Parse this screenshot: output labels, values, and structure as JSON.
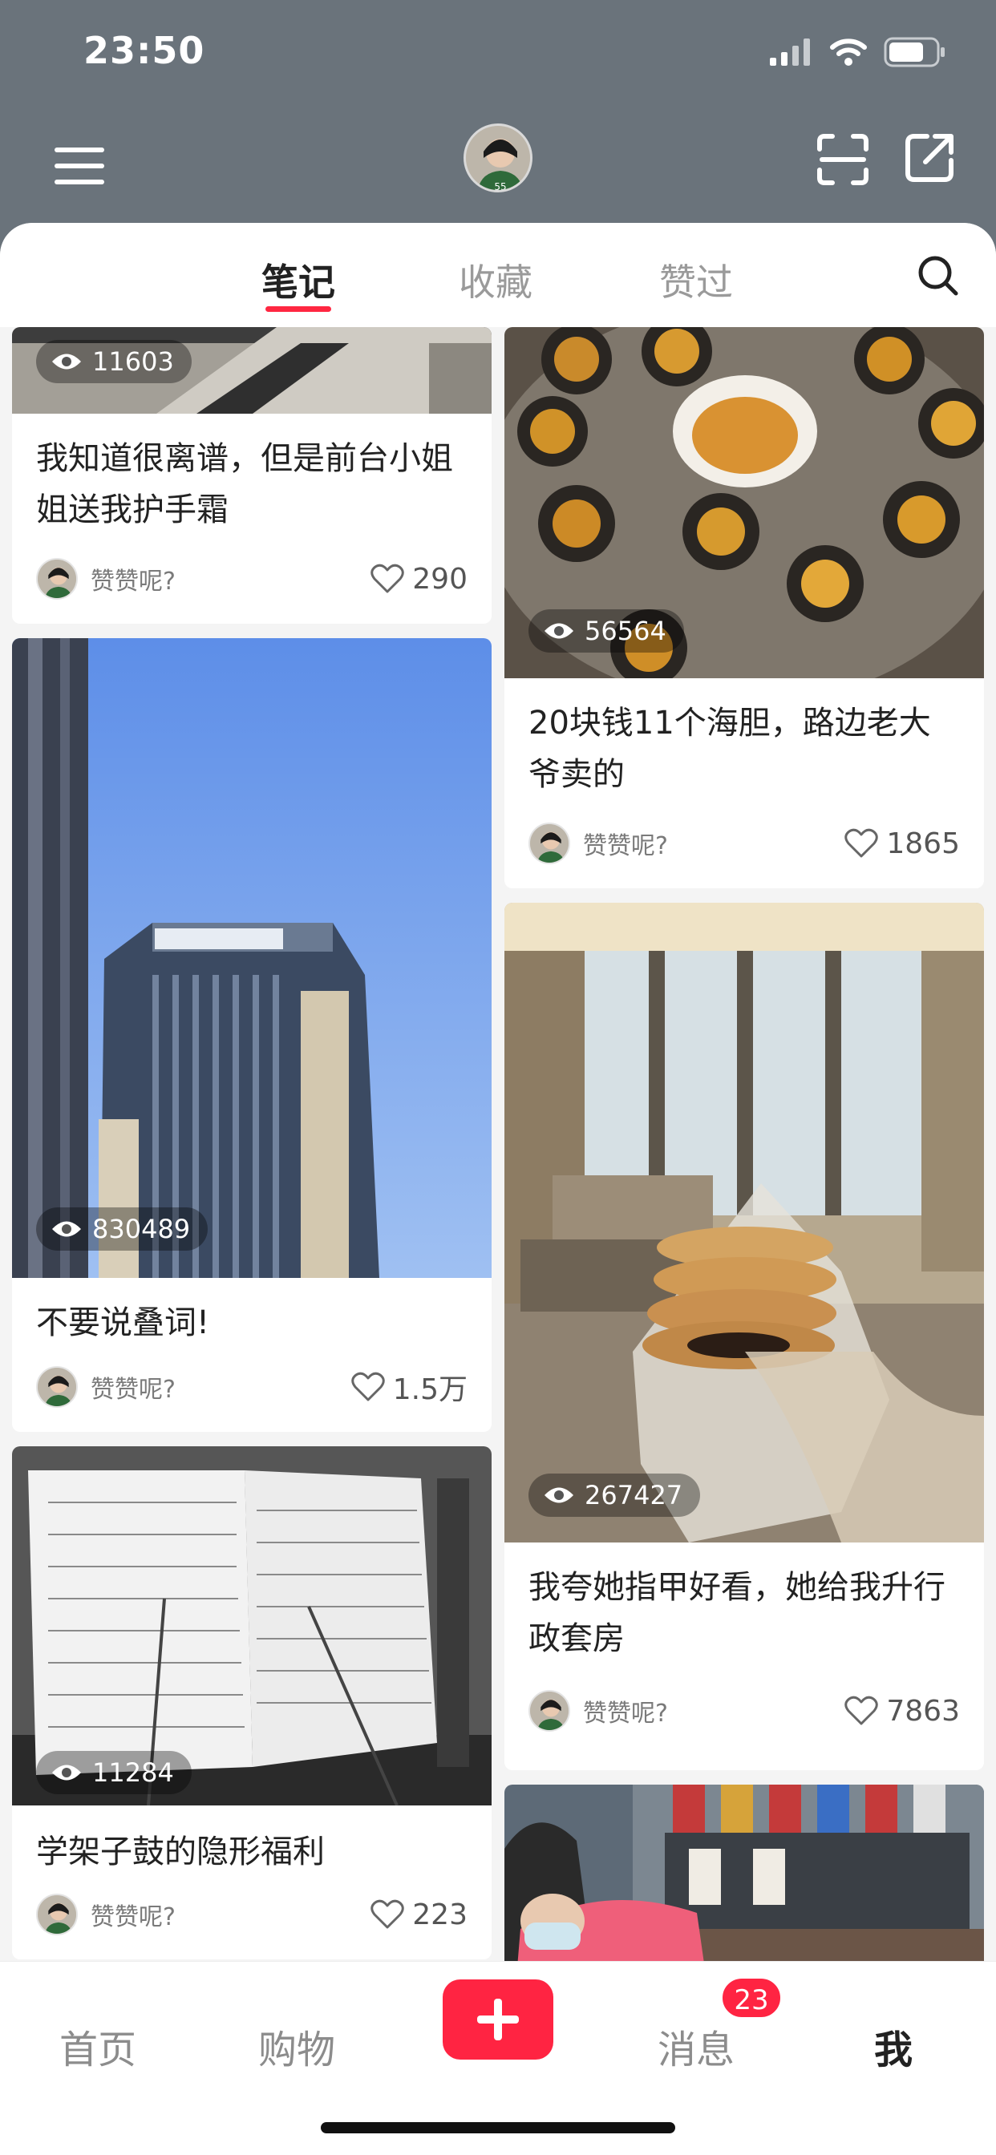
{
  "status_bar": {
    "time": "23:50"
  },
  "header": {
    "menu_icon": "menu-icon",
    "scan_icon": "scan-icon",
    "share_icon": "share-icon"
  },
  "tabs": [
    {
      "label": "笔记",
      "active": true
    },
    {
      "label": "收藏",
      "active": false
    },
    {
      "label": "赞过",
      "active": false
    }
  ],
  "feed": {
    "left": [
      {
        "title": "我知道很离谱，但是前台小姐姐送我护手霜",
        "author": "赞赞呢?",
        "likes": "290",
        "views": "11603"
      },
      {
        "title": "不要说叠词!",
        "author": "赞赞呢?",
        "likes": "1.5万",
        "views": "830489"
      },
      {
        "title": "学架子鼓的隐形福利",
        "author": "赞赞呢?",
        "likes": "223",
        "views": "11284"
      }
    ],
    "right": [
      {
        "title": "20块钱11个海胆，路边老大爷卖的",
        "author": "赞赞呢?",
        "likes": "1865",
        "views": "56564"
      },
      {
        "title": "我夸她指甲好看，她给我升行政套房",
        "author": "赞赞呢?",
        "likes": "7863",
        "views": "267427"
      },
      {
        "title": "",
        "author": "",
        "likes": "",
        "views": ""
      }
    ]
  },
  "bottom_nav": [
    {
      "label": "首页",
      "active": false
    },
    {
      "label": "购物",
      "active": false
    },
    {
      "label": "消息",
      "active": false,
      "badge": "23"
    },
    {
      "label": "我",
      "active": true
    }
  ],
  "colors": {
    "accent": "#ff2442",
    "header_bg": "#6a737b"
  }
}
